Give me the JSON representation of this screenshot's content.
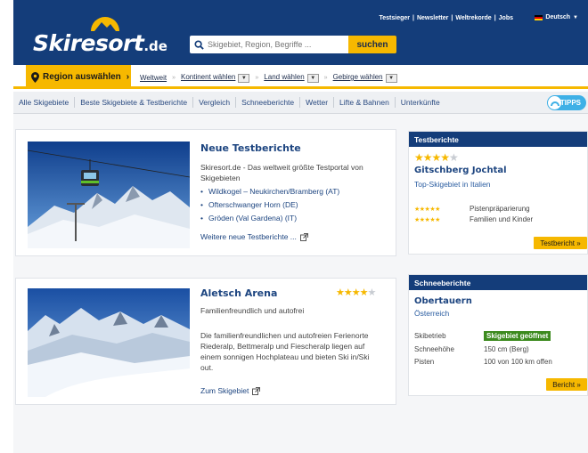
{
  "header": {
    "logo_main": "Skiresort",
    "logo_tld": ".de",
    "search_placeholder": "Skigebiet, Region, Begriffe ...",
    "search_button": "suchen",
    "top_links": [
      "Testsieger",
      "Newsletter",
      "Weltrekorde",
      "Jobs"
    ],
    "language": "Deutsch"
  },
  "region": {
    "button": "Region auswählen",
    "crumbs": [
      "Weltweit",
      "Kontinent wählen",
      "Land wählen",
      "Gebirge wählen"
    ]
  },
  "nav": {
    "items": [
      "Alle Skigebiete",
      "Beste Skigebiete & Testberichte",
      "Vergleich",
      "Schneeberichte",
      "Wetter",
      "Lifte & Bahnen",
      "Unterkünfte"
    ],
    "tipps": "TIPPS"
  },
  "card1": {
    "title": "Neue Testberichte",
    "text": "Skiresort.de - Das weltweit größte Testportal von Skigebieten",
    "bullets": [
      "Wildkogel – Neukirchen/Bramberg (AT)",
      "Ofterschwanger Horn (DE)",
      "Gröden (Val Gardena) (IT)"
    ],
    "link": "Weitere neue Testberichte ..."
  },
  "card2": {
    "title": "Aletsch Arena",
    "rating": 4.5,
    "subtitle": "Familienfreundlich und autofrei",
    "text": "Die familienfreundlichen und autofreien Ferienorte Riederalp, Bettmeralp und Fiescheralp liegen auf einem sonnigen Hochplateau und bieten Ski in/Ski out.",
    "link": "Zum Skigebiet"
  },
  "side1": {
    "header": "Testberichte",
    "rating": 4,
    "title": "Gitschberg Jochtal",
    "subtitle": "Top-Skigebiet in Italien",
    "rows": [
      {
        "stars": 5,
        "label": "Pistenpräparierung"
      },
      {
        "stars": 5,
        "label": "Familien und Kinder"
      }
    ],
    "button": "Testbericht »"
  },
  "side2": {
    "header": "Schneeberichte",
    "title": "Obertauern",
    "subtitle": "Österreich",
    "rows": [
      {
        "label": "Skibetrieb",
        "value": "Skigebiet geöffnet"
      },
      {
        "label": "Schneehöhe",
        "value": "150 cm (Berg)"
      },
      {
        "label": "Pisten",
        "value": "100 von 100 km offen"
      }
    ],
    "button": "Bericht »"
  },
  "colors": {
    "brand_blue": "#143d7a",
    "accent_yellow": "#f6b800",
    "status_green": "#3c8a1e"
  }
}
